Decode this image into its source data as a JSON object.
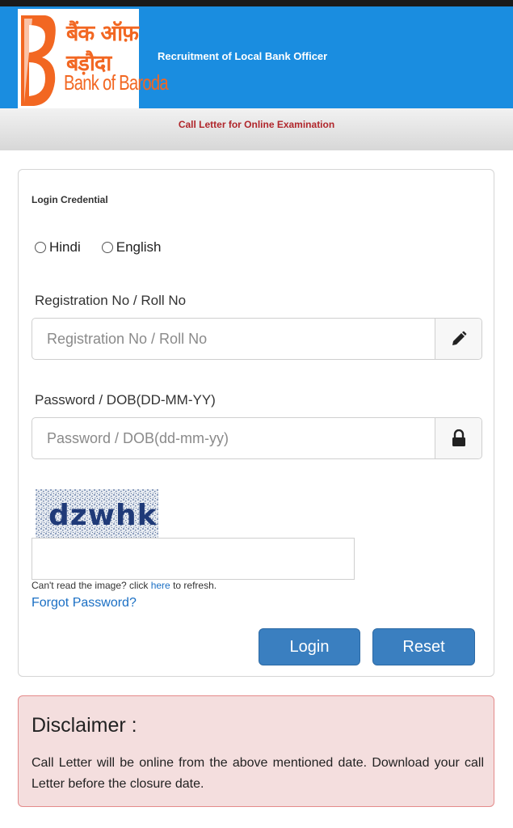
{
  "header": {
    "logo_hindi": "बैंक ऑफ़ बड़ौदा",
    "logo_english": "Bank of Baroda",
    "title": "Recruitment of Local Bank Officer",
    "brand_color": "#f26722",
    "bar_color": "#1a8de0"
  },
  "subheader": {
    "title": "Call Letter for Online Examination"
  },
  "login": {
    "heading": "Login Credential",
    "language_options": [
      {
        "label": "Hindi",
        "selected": false
      },
      {
        "label": "English",
        "selected": false
      }
    ],
    "registration": {
      "label": "Registration No / Roll No",
      "placeholder": "Registration No / Roll No",
      "icon": "pencil-icon"
    },
    "password": {
      "label": "Password / DOB(DD-MM-YY)",
      "placeholder": "Password / DOB(dd-mm-yy)",
      "icon": "lock-icon"
    },
    "captcha": {
      "text": "dzwhk",
      "help_prefix": "Can't read the image? click ",
      "help_link": "here",
      "help_suffix": " to refresh."
    },
    "forgot_password": "Forgot Password?",
    "login_button": "Login",
    "reset_button": "Reset"
  },
  "disclaimer": {
    "title": "Disclaimer :",
    "text": "Call Letter will be online from the above mentioned date. Download your call Letter before the closure date."
  }
}
